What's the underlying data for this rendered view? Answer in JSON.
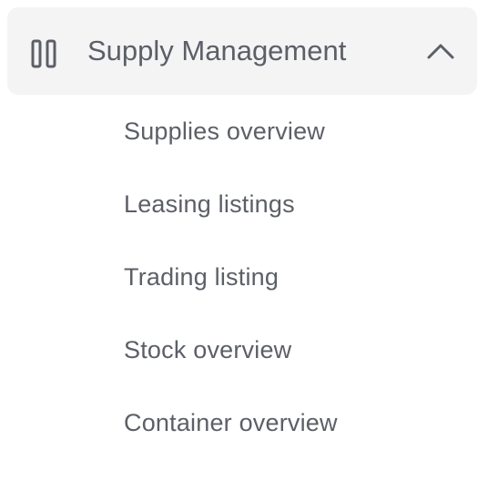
{
  "menu": {
    "header": {
      "title": "Supply Management",
      "icon": "columns-icon",
      "toggle_icon": "chevron-up-icon",
      "expanded": true
    },
    "items": [
      {
        "label": "Supplies overview"
      },
      {
        "label": "Leasing listings"
      },
      {
        "label": "Trading listing"
      },
      {
        "label": "Stock overview"
      },
      {
        "label": "Container overview"
      }
    ]
  },
  "colors": {
    "header_background": "#f4f4f5",
    "text": "#5c5f66",
    "icon": "#5c5f66"
  }
}
